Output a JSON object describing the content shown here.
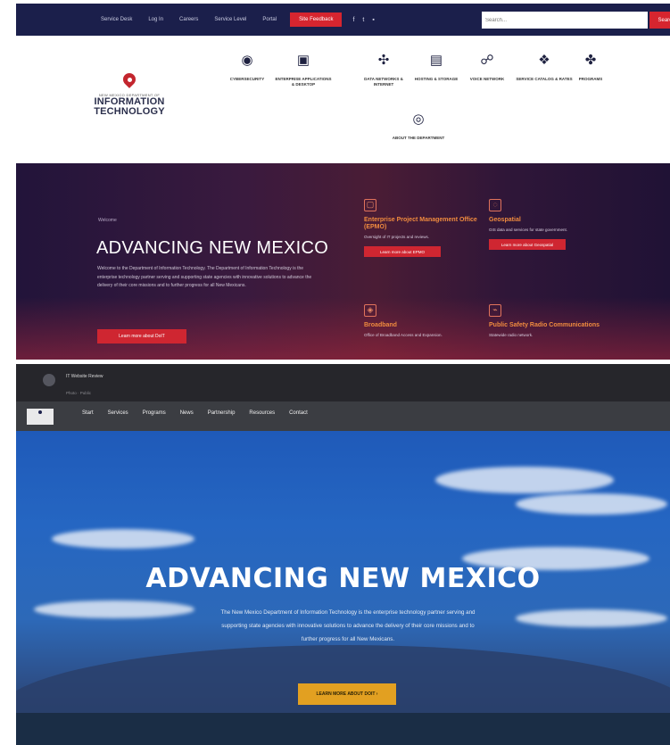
{
  "top": {
    "links": [
      "Service Desk",
      "Log In",
      "Careers",
      "Service Level",
      "Portal"
    ],
    "skip_label": "Site Feedback",
    "social": [
      "f",
      "t",
      "▪"
    ],
    "search_placeholder": "Search...",
    "search_button": "Search"
  },
  "brand": {
    "line1": "NEW MEXICO DEPARTMENT OF",
    "line2": "INFORMATION",
    "line3": "TECHNOLOGY"
  },
  "services": [
    {
      "icon": "cybersecurity-icon",
      "glyph": "◉",
      "label": "CYBERSECURITY"
    },
    {
      "icon": "enterprise-apps-icon",
      "glyph": "▣",
      "label": "ENTERPRISE APPLICATIONS & DESKTOP"
    },
    {
      "icon": "networks-icon",
      "glyph": "✣",
      "label": "DATA NETWORKS & INTERNET"
    },
    {
      "icon": "hosting-icon",
      "glyph": "▤",
      "label": "HOSTING & STORAGE"
    },
    {
      "icon": "voice-network-icon",
      "glyph": "☍",
      "label": "VOICE NETWORK"
    },
    {
      "icon": "service-catalog-icon",
      "glyph": "❖",
      "label": "SERVICE CATALOG & RATES"
    },
    {
      "icon": "programs-icon",
      "glyph": "✤",
      "label": "PROGRAMS"
    },
    {
      "icon": "about-icon",
      "glyph": "◎",
      "label": "ABOUT THE DEPARTMENT"
    }
  ],
  "hero1": {
    "eyebrow": "Welcome",
    "title": "ADVANCING NEW MEXICO",
    "paragraph": "Welcome to the Department of Information Technology. The Department of Information Technology is the enterprise technology partner serving and supporting state agencies with innovative solutions to advance the delivery of their core missions and to further progress for all New Mexicans.",
    "cta": "Learn more about DoIT",
    "tiles": [
      {
        "title": "Enterprise Project Management Office (EPMO)",
        "text": "Oversight of IT projects and reviews.",
        "button": "Learn more about EPMO"
      },
      {
        "title": "Geospatial",
        "text": "GIS data and services for state government.",
        "button": "Learn more about Geospatial"
      },
      {
        "title": "Broadband",
        "text": "Office of Broadband Access and Expansion.",
        "button": ""
      },
      {
        "title": "Public Safety Radio Communications",
        "text": "Statewide radio network.",
        "button": ""
      }
    ]
  },
  "site": {
    "profile_name": "IT Website Review",
    "profile_sub": "Photo · Public",
    "nav": [
      "Start",
      "Services",
      "Programs",
      "News",
      "Partnership",
      "Resources",
      "Contact"
    ],
    "title": "ADVANCING NEW MEXICO",
    "paragraph": "The New Mexico Department of Information Technology is the enterprise technology partner serving and supporting state agencies with innovative solutions to advance the delivery of their core missions and to further progress for all New Mexicans.",
    "cta": "LEARN MORE ABOUT DOIT  ›"
  }
}
